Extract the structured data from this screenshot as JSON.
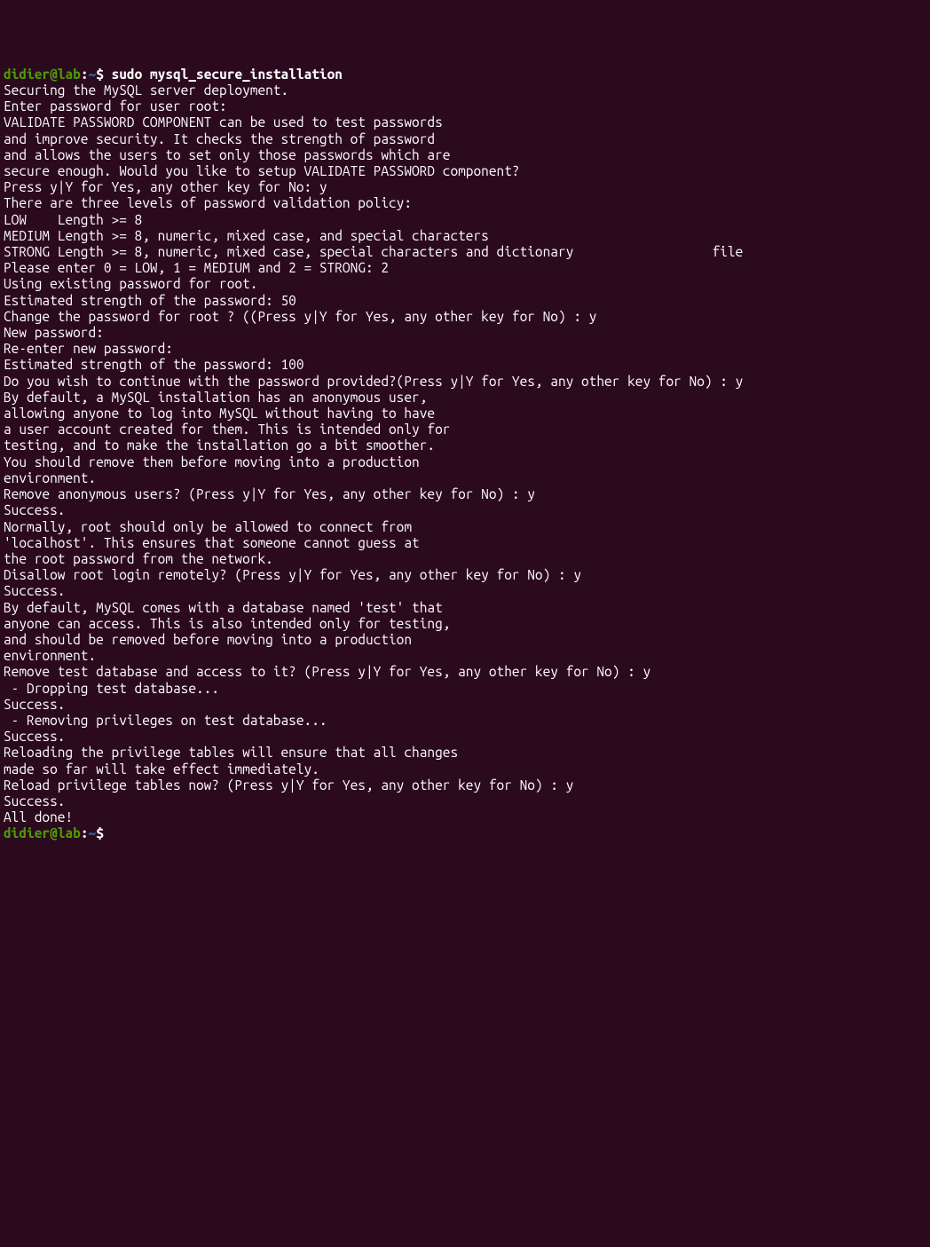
{
  "prompt1": {
    "userhost": "didier@lab",
    "colon": ":",
    "tilde": "~",
    "dollar": "$ ",
    "command": "sudo mysql_secure_installation"
  },
  "lines": {
    "l01": "",
    "l02": "Securing the MySQL server deployment.",
    "l03": "",
    "l04": "Enter password for user root:",
    "l05": "",
    "l06": "VALIDATE PASSWORD COMPONENT can be used to test passwords",
    "l07": "and improve security. It checks the strength of password",
    "l08": "and allows the users to set only those passwords which are",
    "l09": "secure enough. Would you like to setup VALIDATE PASSWORD component?",
    "l10": "",
    "l11": "Press y|Y for Yes, any other key for No: y",
    "l12": "",
    "l13": "There are three levels of password validation policy:",
    "l14": "",
    "l15": "LOW    Length >= 8",
    "l16": "MEDIUM Length >= 8, numeric, mixed case, and special characters",
    "l17": "STRONG Length >= 8, numeric, mixed case, special characters and dictionary                  file",
    "l18": "",
    "l19": "Please enter 0 = LOW, 1 = MEDIUM and 2 = STRONG: 2",
    "l20": "Using existing password for root.",
    "l21": "",
    "l22": "Estimated strength of the password: 50",
    "l23": "Change the password for root ? ((Press y|Y for Yes, any other key for No) : y",
    "l24": "",
    "l25": "New password:",
    "l26": "",
    "l27": "Re-enter new password:",
    "l28": "",
    "l29": "Estimated strength of the password: 100",
    "l30": "Do you wish to continue with the password provided?(Press y|Y for Yes, any other key for No) : y",
    "l31": "By default, a MySQL installation has an anonymous user,",
    "l32": "allowing anyone to log into MySQL without having to have",
    "l33": "a user account created for them. This is intended only for",
    "l34": "testing, and to make the installation go a bit smoother.",
    "l35": "You should remove them before moving into a production",
    "l36": "environment.",
    "l37": "",
    "l38": "Remove anonymous users? (Press y|Y for Yes, any other key for No) : y",
    "l39": "Success.",
    "l40": "",
    "l41": "",
    "l42": "Normally, root should only be allowed to connect from",
    "l43": "'localhost'. This ensures that someone cannot guess at",
    "l44": "the root password from the network.",
    "l45": "",
    "l46": "Disallow root login remotely? (Press y|Y for Yes, any other key for No) : y",
    "l47": "Success.",
    "l48": "",
    "l49": "By default, MySQL comes with a database named 'test' that",
    "l50": "anyone can access. This is also intended only for testing,",
    "l51": "and should be removed before moving into a production",
    "l52": "environment.",
    "l53": "",
    "l54": "",
    "l55": "Remove test database and access to it? (Press y|Y for Yes, any other key for No) : y",
    "l56": " - Dropping test database...",
    "l57": "Success.",
    "l58": "",
    "l59": " - Removing privileges on test database...",
    "l60": "Success.",
    "l61": "",
    "l62": "Reloading the privilege tables will ensure that all changes",
    "l63": "made so far will take effect immediately.",
    "l64": "",
    "l65": "Reload privilege tables now? (Press y|Y for Yes, any other key for No) : y",
    "l66": "Success.",
    "l67": "",
    "l68": "All done!"
  },
  "prompt2": {
    "userhost": "didier@lab",
    "colon": ":",
    "tilde": "~",
    "dollar": "$ "
  }
}
